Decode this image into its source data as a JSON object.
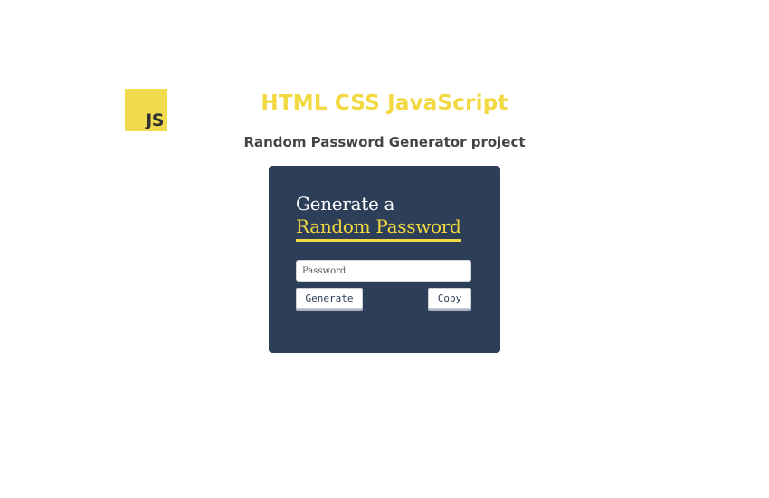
{
  "logo": {
    "text": "JS"
  },
  "header": {
    "title": "HTML CSS JavaScript",
    "subtitle": "Random Password Generator project"
  },
  "card": {
    "heading_line1": "Generate a",
    "heading_line2": "Random Password",
    "password_placeholder": "Password",
    "password_value": "",
    "generate_label": "Generate",
    "copy_label": "Copy"
  },
  "colors": {
    "accent_yellow": "#f2d841",
    "card_bg": "#2d3e58",
    "logo_bg": "#f0db4f"
  }
}
